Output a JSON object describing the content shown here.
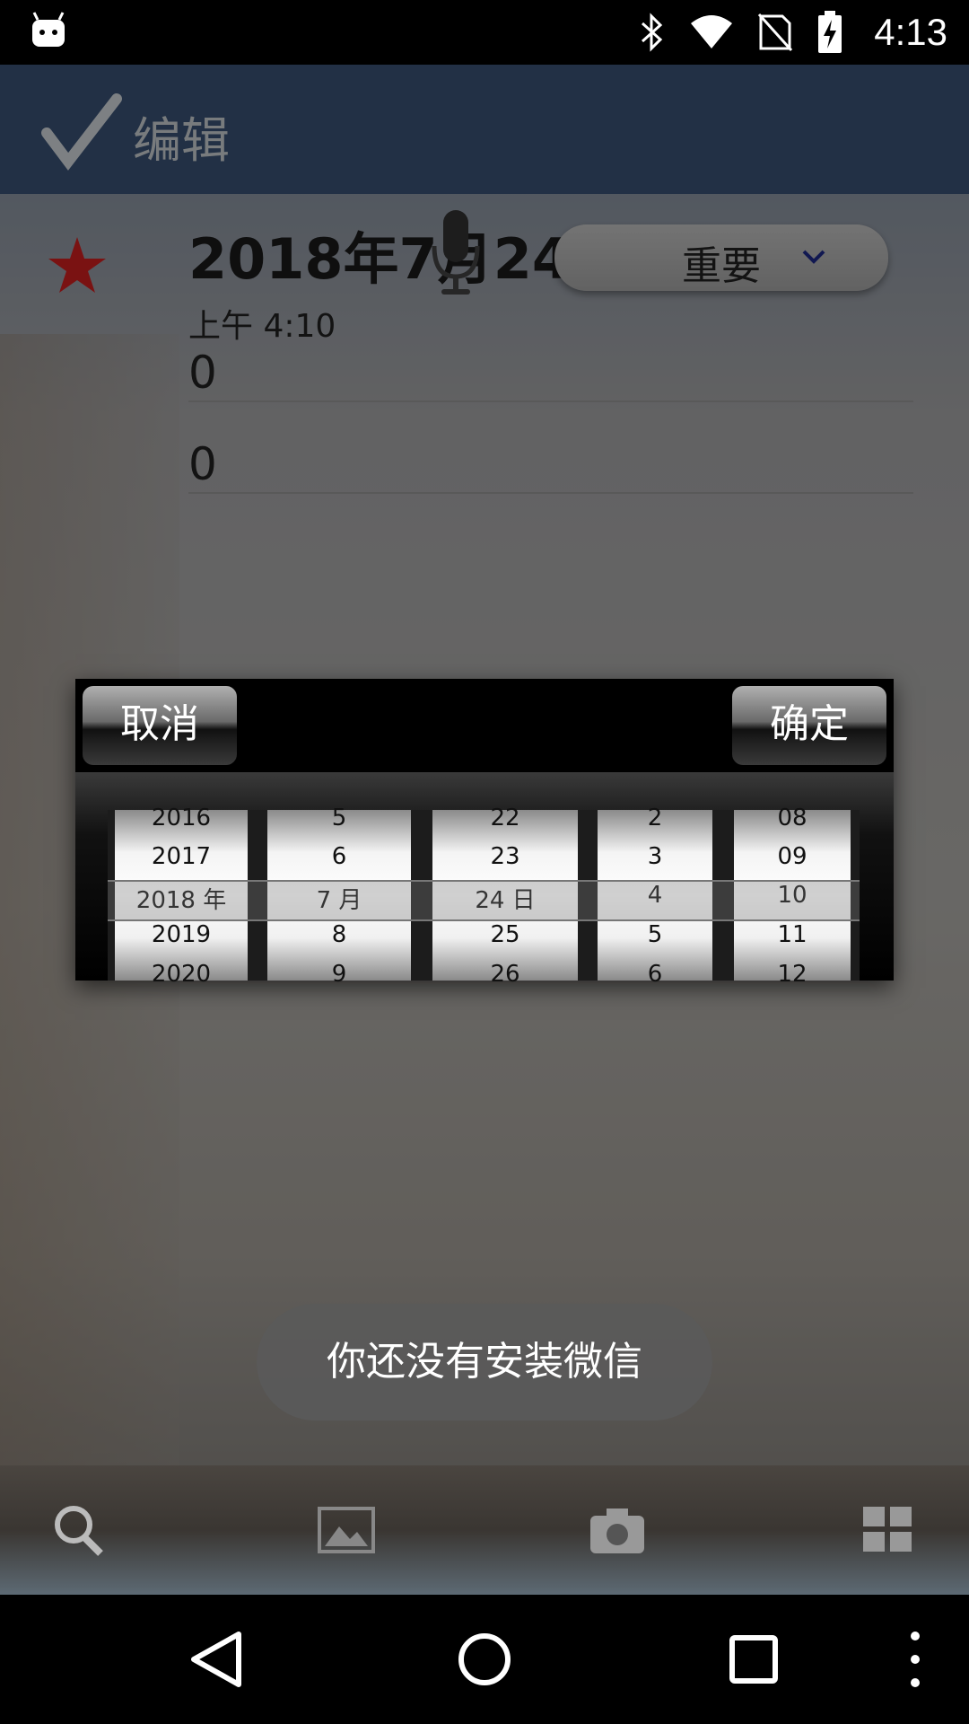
{
  "status_bar": {
    "time": "4:13",
    "icons": [
      "android-debug-icon",
      "bluetooth-icon",
      "wifi-icon",
      "no-sim-icon",
      "battery-charging-icon"
    ]
  },
  "action_bar": {
    "title": "编辑"
  },
  "note": {
    "date_title": "2018年7月24日",
    "time_text": "上午 4:10",
    "priority": "重要",
    "field1_value": "0",
    "field2_value": "0"
  },
  "dialog": {
    "cancel_label": "取消",
    "ok_label": "确定",
    "columns": [
      {
        "name": "year",
        "items": [
          "2016",
          "2017",
          "2018 年",
          "2019",
          "2020"
        ]
      },
      {
        "name": "month",
        "items": [
          "5",
          "6",
          "7 月",
          "8",
          "9"
        ]
      },
      {
        "name": "day",
        "items": [
          "22",
          "23",
          "24 日",
          "25",
          "26"
        ]
      },
      {
        "name": "hour",
        "items": [
          "2",
          "3",
          "4",
          "5",
          "6"
        ]
      },
      {
        "name": "minute",
        "items": [
          "08",
          "09",
          "10",
          "11",
          "12"
        ]
      }
    ]
  },
  "toast": {
    "message": "你还没有安装微信"
  },
  "toolbar": {
    "items": [
      "search-icon",
      "gallery-icon",
      "camera-icon",
      "grid-icon"
    ]
  },
  "colors": {
    "action_bar": "#3b5478",
    "star": "#d21f1f",
    "chevron": "#1e2a8c"
  }
}
